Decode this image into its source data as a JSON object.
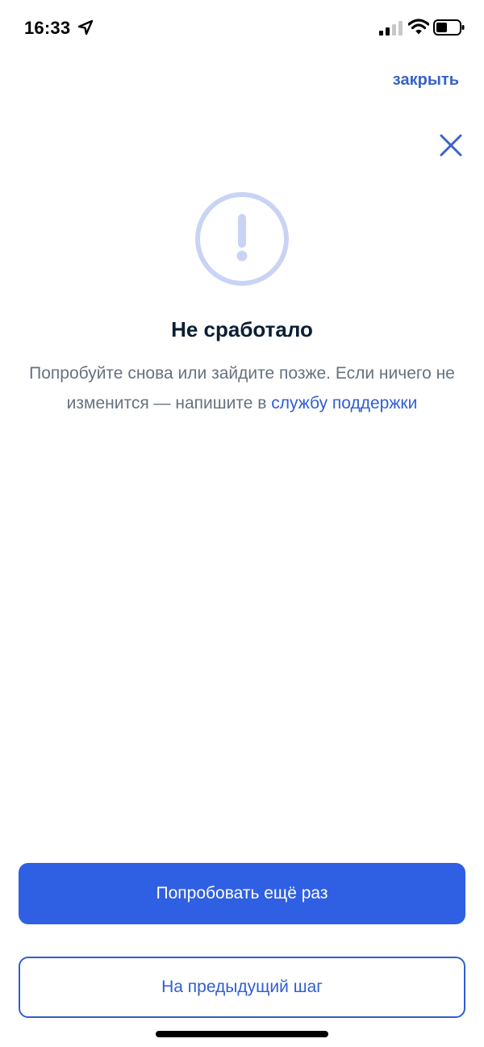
{
  "status_bar": {
    "time": "16:33",
    "icons": [
      "location-arrow-icon",
      "cellular-signal-icon",
      "wifi-icon",
      "battery-icon"
    ]
  },
  "header": {
    "close_link_label": "закрыть",
    "close_icon": "close-x-icon"
  },
  "error": {
    "icon": "exclamation-circle-icon",
    "title": "Не сработало",
    "description_text": "Попробуйте снова или зайдите позже. Если ничего не изменится — напишите в ",
    "support_link_label": "службу поддержки"
  },
  "actions": {
    "retry_label": "Попробовать ещё раз",
    "back_label": "На предыдущий шаг"
  },
  "colors": {
    "accent": "#2f5fe3",
    "link": "#2f5fd0",
    "icon_ring": "#c9d4f5",
    "title": "#0b1f33",
    "text_secondary": "#66727f"
  }
}
